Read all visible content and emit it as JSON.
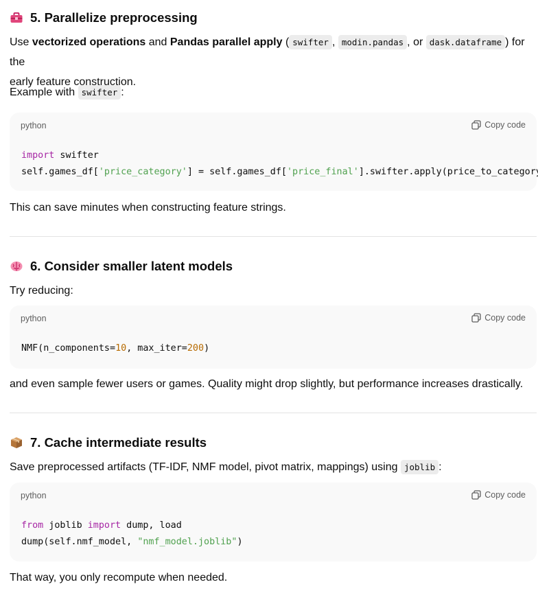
{
  "section5": {
    "title": "5. Parallelize preprocessing",
    "icon": "toolbox-icon",
    "p1_pre": "Use ",
    "p1_b1": "vectorized operations",
    "p1_mid": " and ",
    "p1_b2": "Pandas parallel apply",
    "p1_open": " (",
    "code1": "swifter",
    "sep1": ", ",
    "code2": "modin.pandas",
    "sep2": ", or ",
    "code3": "dask.dataframe",
    "p1_post": ") for the",
    "p1_line2": "early feature construction.",
    "example_pre": "Example with ",
    "example_code": "swifter",
    "example_post": ":",
    "codeblock": {
      "lang": "python",
      "copy": "Copy code",
      "l1_kw": "import",
      "l1_rest": " swifter",
      "l2_a": "self.games_df[",
      "l2_s1": "'price_category'",
      "l2_b": "] = self.games_df[",
      "l2_s2": "'price_final'",
      "l2_c": "].swifter.apply(price_to_category)"
    },
    "after": "This can save minutes when constructing feature strings."
  },
  "section6": {
    "title": "6. Consider smaller latent models",
    "icon": "brain-icon",
    "intro": "Try reducing:",
    "codeblock": {
      "lang": "python",
      "copy": "Copy code",
      "l1_a": "NMF(n_components=",
      "l1_n1": "10",
      "l1_b": ", max_iter=",
      "l1_n2": "200",
      "l1_c": ")"
    },
    "after": "and even sample fewer users or games. Quality might drop slightly, but performance increases drastically."
  },
  "section7": {
    "title": "7. Cache intermediate results",
    "icon": "package-icon",
    "intro_pre": "Save preprocessed artifacts (TF-IDF, NMF model, pivot matrix, mappings) using ",
    "intro_code": "joblib",
    "intro_post": ":",
    "codeblock": {
      "lang": "python",
      "copy": "Copy code",
      "l1_kw1": "from",
      "l1_a": " joblib ",
      "l1_kw2": "import",
      "l1_b": " dump, load",
      "l2_a": "dump(self.nmf_model, ",
      "l2_s": "\"nmf_model.joblib\"",
      "l2_b": ")"
    },
    "after": "That way, you only recompute when needed."
  }
}
